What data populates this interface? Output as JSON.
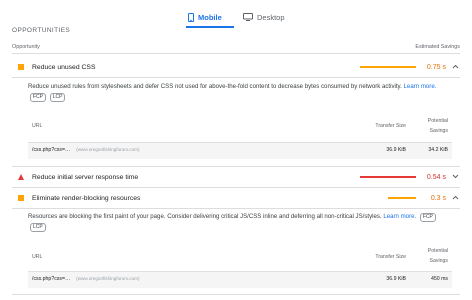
{
  "tabs": [
    {
      "label": "Mobile",
      "icon": "smartphone-icon",
      "active": true
    },
    {
      "label": "Desktop",
      "icon": "monitor-icon",
      "active": false
    }
  ],
  "section_title": "OPPORTUNITIES",
  "columns": {
    "left": "Opportunity",
    "right": "Estimated Savings"
  },
  "audits": [
    {
      "title": "Reduce unused CSS",
      "value": "0.75 s",
      "severity": "average",
      "expanded": true,
      "description": "Reduce unused rules from stylesheets and defer CSS not used for above-the-fold content to decrease bytes consumed by network activity.",
      "learn_more": "Learn more.",
      "metrics": [
        "FCP",
        "LCP"
      ],
      "table": {
        "headers": {
          "url": "URL",
          "size": "Transfer Size",
          "savings_1": "Potential",
          "savings_2": "Savings"
        },
        "row": {
          "url": "/css.php?css=…",
          "host": "(www.oregonfishingforum.com)",
          "size": "36.9 KiB",
          "savings": "34.2 KiB"
        }
      }
    },
    {
      "title": "Reduce initial server response time",
      "value": "0.54 s",
      "severity": "fail",
      "expanded": false
    },
    {
      "title": "Eliminate render-blocking resources",
      "value": "0.3 s",
      "severity": "average",
      "expanded": true,
      "description_a": "Resources are blocking the first paint of your page. Consider delivering critical JS/CSS inline and deferring all non-critical JS/styles.",
      "learn_more": "Learn",
      "learn_more_b": "more.",
      "metrics": [
        "FCP",
        "LCP"
      ],
      "table": {
        "headers": {
          "url": "URL",
          "size": "Transfer Size",
          "savings_1": "Potential",
          "savings_2": "Savings"
        },
        "row": {
          "url": "/css.php?css=…",
          "host": "(www.oregonfishingforum.com)",
          "size": "36.9 KiB",
          "savings": "450 ms"
        }
      }
    }
  ],
  "colors": {
    "accent": "#1a73e8",
    "average": "#ffa400",
    "fail": "#e53935"
  }
}
